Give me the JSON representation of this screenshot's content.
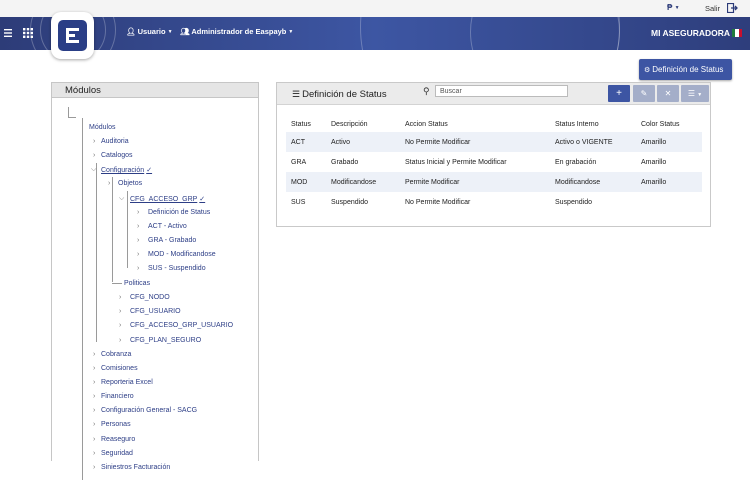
{
  "topbar": {
    "lang_label": "₱",
    "salir_label": "Salir"
  },
  "navbar": {
    "user_label": "Usuario",
    "admin_label": "Administrador de Easpayb",
    "brand": "MI ASEGURADORA",
    "flag_colors": [
      "#1f7a3d",
      "#ffffff",
      "#c8102e"
    ]
  },
  "action_button": {
    "label": "Definición de Status"
  },
  "modulos": {
    "title": "Módulos",
    "root": "Módulos",
    "items": [
      "Auditoria",
      "Catalogos",
      "Configuración",
      "Objetos",
      "CFG_ACCESO_GRP",
      "Definición de Status",
      "ACT - Activo",
      "GRA - Grabado",
      "MOD - Modificandose",
      "SUS - Suspendido",
      "Politicas",
      "CFG_NODO",
      "CFG_USUARIO",
      "CFG_ACCESO_GRP_USUARIO",
      "CFG_PLAN_SEGURO",
      "Cobranza",
      "Comisiones",
      "Reporteria Excel",
      "Financiero",
      "Configuración General - SACG",
      "Personas",
      "Reaseguro",
      "Seguridad",
      "Siniestros Facturación"
    ]
  },
  "status_panel": {
    "title": "Definición de Status",
    "search_placeholder": "Buscar",
    "columns": [
      "Status",
      "Descripción",
      "Accion Status",
      "Status Interno",
      "Color Status"
    ],
    "rows": [
      [
        "ACT",
        "Activo",
        "No Permite Modificar",
        "Activo o VIGENTE",
        "Amarillo"
      ],
      [
        "GRA",
        "Grabado",
        "Status Inicial y Permite Modificar",
        "En grabación",
        "Amarillo"
      ],
      [
        "MOD",
        "Modificandose",
        "Permite Modificar",
        "Modificandose",
        "Amarillo"
      ],
      [
        "SUS",
        "Suspendido",
        "No Permite Modificar",
        "Suspendido",
        ""
      ]
    ]
  }
}
